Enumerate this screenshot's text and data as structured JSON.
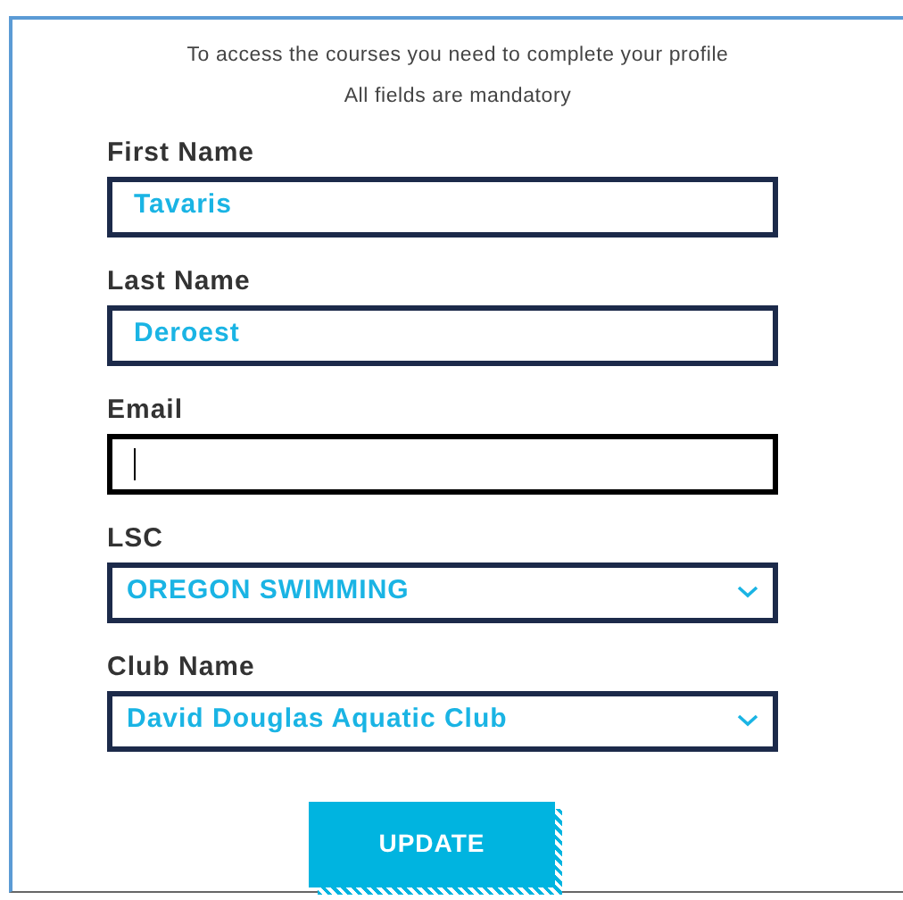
{
  "intro": [
    "To access the courses you need to complete your profile",
    "All fields are mandatory"
  ],
  "fields": [
    {
      "label": "First Name",
      "kind": "text",
      "value": "Tavaris",
      "focused": false
    },
    {
      "label": "Last Name",
      "kind": "text",
      "value": "Deroest",
      "focused": false
    },
    {
      "label": "Email",
      "kind": "text",
      "focused": true
    },
    {
      "label": "LSC",
      "kind": "select",
      "value": "OREGON SWIMMING",
      "focused": false
    },
    {
      "label": "Club Name",
      "kind": "select",
      "value": "David Douglas Aquatic Club",
      "focused": false
    }
  ],
  "button": "UPDATE"
}
